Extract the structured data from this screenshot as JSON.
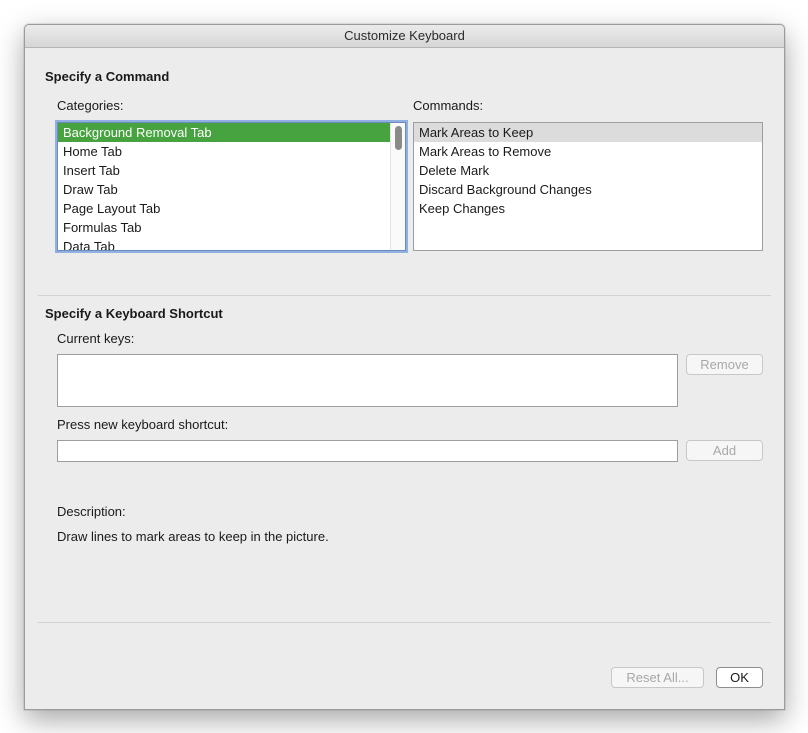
{
  "window": {
    "title": "Customize Keyboard"
  },
  "command_section": {
    "title": "Specify a Command",
    "categories_label": "Categories:",
    "commands_label": "Commands:",
    "categories": [
      "Background Removal Tab",
      "Home Tab",
      "Insert Tab",
      "Draw Tab",
      "Page Layout Tab",
      "Formulas Tab",
      "Data Tab"
    ],
    "selected_category": "Background Removal Tab",
    "commands": [
      "Mark Areas to Keep",
      "Mark Areas to Remove",
      "Delete Mark",
      "Discard Background Changes",
      "Keep Changes"
    ],
    "selected_command": "Mark Areas to Keep"
  },
  "shortcut_section": {
    "title": "Specify a Keyboard Shortcut",
    "current_keys_label": "Current keys:",
    "current_keys_value": "",
    "remove_label": "Remove",
    "new_shortcut_label": "Press new keyboard shortcut:",
    "new_shortcut_value": "",
    "add_label": "Add",
    "description_label": "Description:",
    "description_text": "Draw lines to mark areas to keep in the picture."
  },
  "footer": {
    "reset_all_label": "Reset All...",
    "ok_label": "OK"
  },
  "colors": {
    "selection_green": "#47a33f",
    "selection_gray": "#dcdcdc",
    "focus_ring": "#8fb0e0"
  }
}
